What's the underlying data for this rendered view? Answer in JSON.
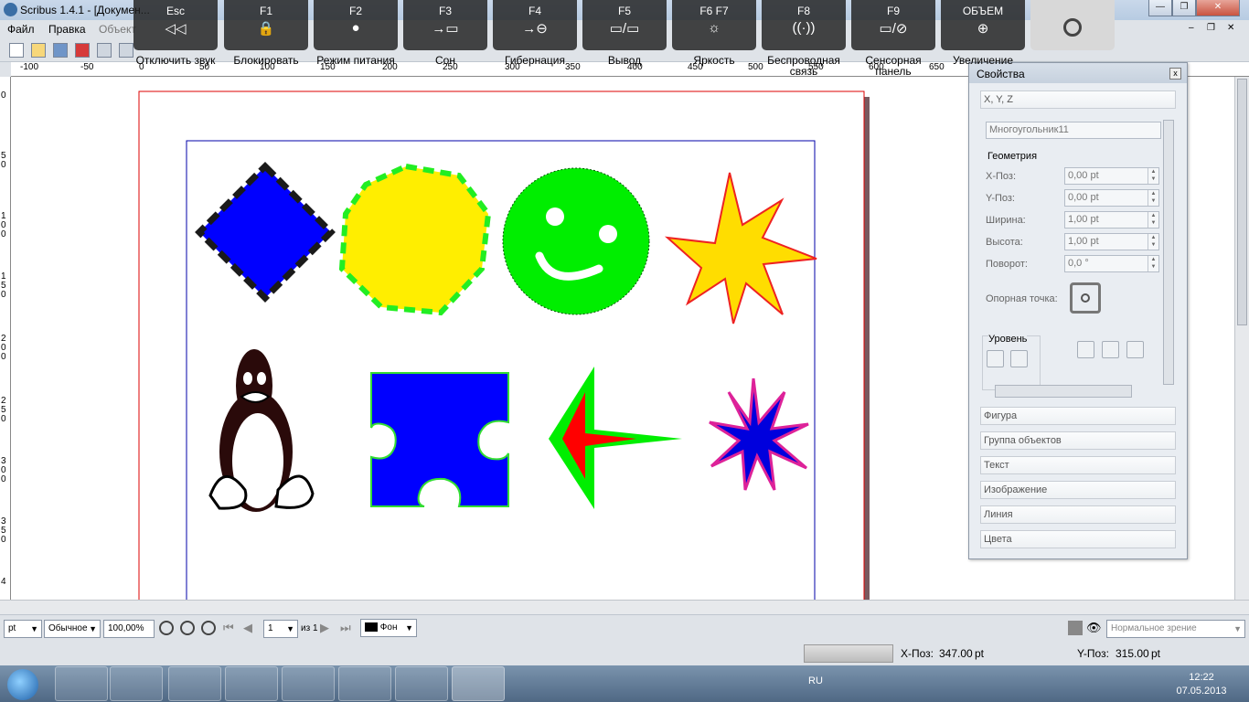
{
  "window": {
    "title": "Scribus 1.4.1 - [Докумен...",
    "controls": [
      "—",
      "❐",
      "✕"
    ],
    "inner_controls": [
      "–",
      "❐",
      "✕"
    ]
  },
  "menu": [
    "Файл",
    "Правка",
    "Объект"
  ],
  "ruler_h_labels": [
    "-100",
    "-50",
    "0",
    "50",
    "100",
    "150",
    "200",
    "250",
    "300",
    "350",
    "400",
    "450",
    "500",
    "550",
    "600",
    "650"
  ],
  "ruler_v_labels": [
    "0",
    "5 0",
    "1 0 0",
    "1 5 0",
    "2 0 0",
    "2 5 0",
    "3 0 0",
    "3 5 0",
    "4"
  ],
  "fkeys": [
    {
      "key": "Esc",
      "icon": "◁◁",
      "caption": "Отключить звук"
    },
    {
      "key": "F1",
      "icon": "🔒",
      "caption": "Блокировать"
    },
    {
      "key": "F2",
      "icon": "●",
      "caption": "Режим питания"
    },
    {
      "key": "F3",
      "icon": "→▭",
      "caption": "Сон"
    },
    {
      "key": "F4",
      "icon": "→⊖",
      "caption": "Гибернация"
    },
    {
      "key": "F5",
      "icon": "▭/▭",
      "caption": "Вывод"
    },
    {
      "key": "F6   F7",
      "icon": "☼",
      "caption": "Яркость"
    },
    {
      "key": "F8",
      "icon": "((·))",
      "caption": "Беспроводная связь"
    },
    {
      "key": "F9",
      "icon": "▭/⊘",
      "caption": "Сенсорная панель"
    },
    {
      "key": "ОБЪЕМ",
      "icon": "⊕",
      "caption": "Увеличение"
    }
  ],
  "properties": {
    "title": "Свойства",
    "close": "x",
    "xyz_section": "X, Y, Z",
    "object_name": "Многоугольник11",
    "geometry_label": "Геометрия",
    "fields": [
      {
        "label": "X-Поз:",
        "value": "0,00 pt"
      },
      {
        "label": "Y-Поз:",
        "value": "0,00 pt"
      },
      {
        "label": "Ширина:",
        "value": "1,00 pt"
      },
      {
        "label": "Высота:",
        "value": "1,00 pt"
      },
      {
        "label": "Поворот:",
        "value": "0,0 °"
      }
    ],
    "basepoint_label": "Опорная точка:",
    "level_label": "Уровень",
    "sections": [
      "Фигура",
      "Группа объектов",
      "Текст",
      "Изображение",
      "Линия",
      "Цвета"
    ]
  },
  "bottom": {
    "unit": "pt",
    "mode": "Обычное",
    "zoom": "100,00%",
    "page": "1",
    "of_pages": "из 1",
    "layer": "Фон",
    "vision": "Нормальное зрение"
  },
  "status": {
    "x_label": "X-Поз:",
    "x_value": "347.00",
    "x_unit": "pt",
    "y_label": "Y-Поз:",
    "y_value": "315.00",
    "y_unit": "pt"
  },
  "taskbar": {
    "lang": "RU",
    "time": "12:22",
    "date": "07.05.2013"
  },
  "colors": {
    "diamond_fill": "#0000ff",
    "heptagon_fill": "#ffee00",
    "heptagon_border": "#22ee22",
    "smiley_fill": "#00ee00",
    "star_fill": "#ffdd00",
    "star_stroke": "#ee2222",
    "puzzle_fill": "#0000ff",
    "arrow_fill": "#ff0000",
    "arrow_border": "#00ee00",
    "small_star_fill": "#0000dd",
    "small_star_stroke": "#dd2299",
    "page_border": "#dd0000",
    "margin_border": "#0000aa"
  }
}
